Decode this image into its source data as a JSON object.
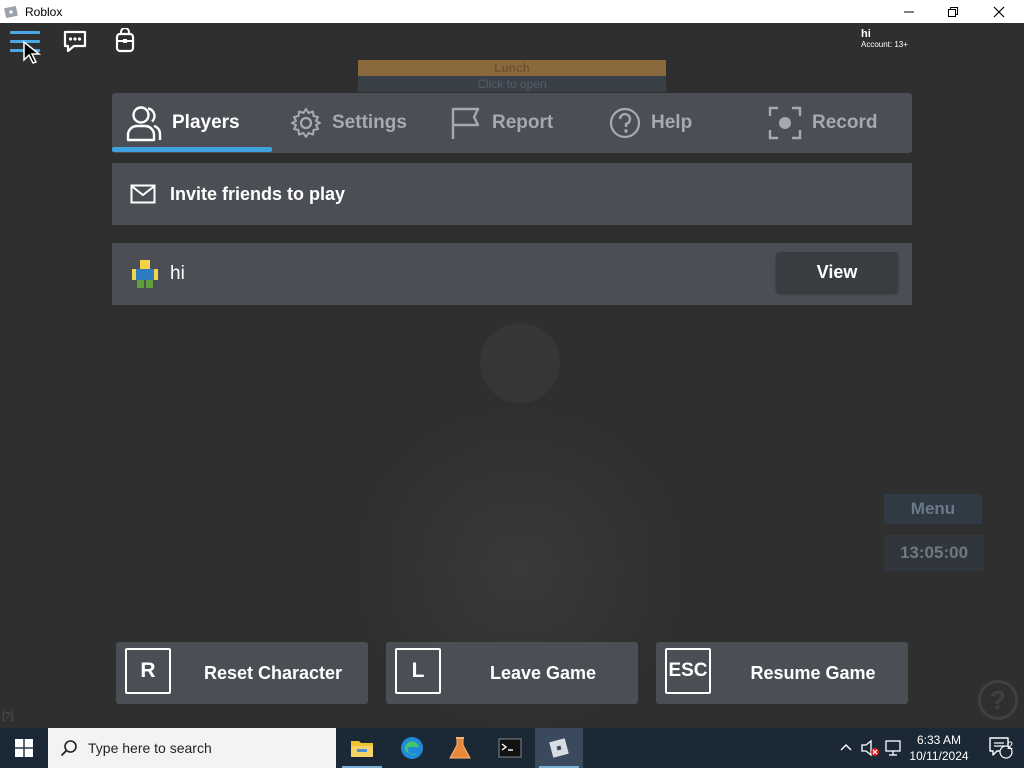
{
  "window": {
    "title": "Roblox",
    "minimize_label": "–",
    "maximize_label": "❐",
    "close_label": "✕"
  },
  "background": {
    "sign_title": "Lunch",
    "sign_subtitle": "Click to open"
  },
  "hud": {
    "menu_icon": "hamburger-icon",
    "chat_icon": "chat-icon",
    "backpack_icon": "backpack-icon",
    "account_name": "hi",
    "account_age": "Account: 13+"
  },
  "tabs": [
    {
      "label": "Players",
      "icon": "players-icon",
      "active": true
    },
    {
      "label": "Settings",
      "icon": "gear-icon",
      "active": false
    },
    {
      "label": "Report",
      "icon": "flag-icon",
      "active": false
    },
    {
      "label": "Help",
      "icon": "help-icon",
      "active": false
    },
    {
      "label": "Record",
      "icon": "record-icon",
      "active": false
    }
  ],
  "invite": {
    "label": "Invite friends to play",
    "icon": "mail-icon"
  },
  "players": [
    {
      "name": "hi",
      "action_label": "View",
      "icon": "avatar-icon"
    }
  ],
  "side": {
    "menu_label": "Menu",
    "clock": "13:05:00",
    "help_glyph": "?",
    "corner_bracket": "[?]"
  },
  "actions": [
    {
      "key": "R",
      "label": "Reset Character"
    },
    {
      "key": "L",
      "label": "Leave Game"
    },
    {
      "key": "ESC",
      "label": "Resume Game"
    }
  ],
  "taskbar": {
    "search_placeholder": "Type here to search",
    "apps": [
      "file-explorer-icon",
      "edge-icon",
      "lab-flask-icon",
      "terminal-icon",
      "roblox-icon"
    ],
    "time": "6:33 AM",
    "date": "10/11/2024",
    "notification_count": "2"
  },
  "colors": {
    "panel": "#4b4f55",
    "accent": "#3ea0dd",
    "taskbar": "#1b2836"
  }
}
